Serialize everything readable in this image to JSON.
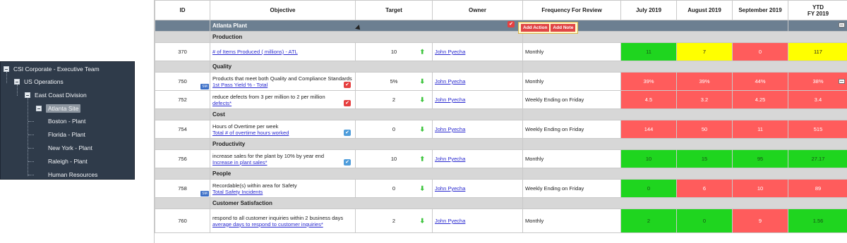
{
  "tree": {
    "items": [
      {
        "label": "CSI Corporate - Executive Team"
      },
      {
        "label": "US Operations"
      },
      {
        "label": "East Coast Division"
      },
      {
        "label": "Atlanta Site"
      },
      {
        "label": "Boston - Plant"
      },
      {
        "label": "Florida - Plant"
      },
      {
        "label": "New York - Plant"
      },
      {
        "label": "Raleigh - Plant"
      },
      {
        "label": "Human Resources"
      }
    ]
  },
  "headers": {
    "id": "ID",
    "objective": "Objective",
    "target": "Target",
    "owner": "Owner",
    "frequency": "Frequency For Review",
    "jul": "July 2019",
    "aug": "August 2019",
    "sep": "September 2019",
    "ytd1": "YTD",
    "ytd2": "FY 2019"
  },
  "plant": "Atlanta Plant",
  "popup": {
    "add_action": "Add Action",
    "add_note": "Add Note"
  },
  "sm_badge": "SM",
  "categories": {
    "production": "Production",
    "quality": "Quality",
    "cost": "Cost",
    "productivity": "Productivity",
    "people": "People",
    "customer": "Customer Satisfaction"
  },
  "rows": [
    {
      "id": "370",
      "desc": "",
      "link": "# of Items Produced ( millions) - ATL",
      "target": "10",
      "owner": "John Pyecha",
      "freq": "Monthly",
      "jul": "11",
      "aug": "7",
      "sep": "0",
      "ytd": "117"
    },
    {
      "id": "750",
      "desc": "Products that meet both Quality and Compliance Standards",
      "link": "1st Pass Yield % - Total",
      "target": "5%",
      "owner": "John Pyecha",
      "freq": "Monthly",
      "jul": "39%",
      "aug": "39%",
      "sep": "44%",
      "ytd": "38%"
    },
    {
      "id": "752",
      "desc": "reduce defects from 3 per million to 2 per million",
      "link": "defects*",
      "target": "2",
      "owner": "John Pyecha",
      "freq": "Weekly Ending on Friday",
      "jul": "4.5",
      "aug": "3.2",
      "sep": "4.25",
      "ytd": "3.4"
    },
    {
      "id": "754",
      "desc": "Hours of Overtime per week",
      "link": "Total # of overtime hours worked",
      "target": "0",
      "owner": "John Pyecha",
      "freq": "Weekly Ending on Friday",
      "jul": "144",
      "aug": "50",
      "sep": "11",
      "ytd": "515"
    },
    {
      "id": "756",
      "desc": "increase sales for the plant by 10% by year end",
      "link": "Increase in plant sales*",
      "target": "10",
      "owner": "John Pyecha",
      "freq": "Monthly",
      "jul": "10",
      "aug": "15",
      "sep": "95",
      "ytd": "27.17"
    },
    {
      "id": "758",
      "desc": "Recordable(s) within area for Safety",
      "link": "Total Safety Incidents",
      "target": "0",
      "owner": "John Pyecha",
      "freq": "Weekly Ending on Friday",
      "jul": "0",
      "aug": "6",
      "sep": "10",
      "ytd": "89"
    },
    {
      "id": "760",
      "desc": "respond to all customer inquiries within 2 business days",
      "link": "average days to respond to customer inquiries*",
      "target": "2",
      "owner": "John Pyecha",
      "freq": "Monthly",
      "jul": "2",
      "aug": "0",
      "sep": "9",
      "ytd": "1.56"
    }
  ],
  "colors": {
    "green": "#1fd51f",
    "red": "#ff5c5c",
    "yellow": "#ffff00",
    "header_band": "#6c7f91",
    "category_band": "#d7d7d7"
  }
}
